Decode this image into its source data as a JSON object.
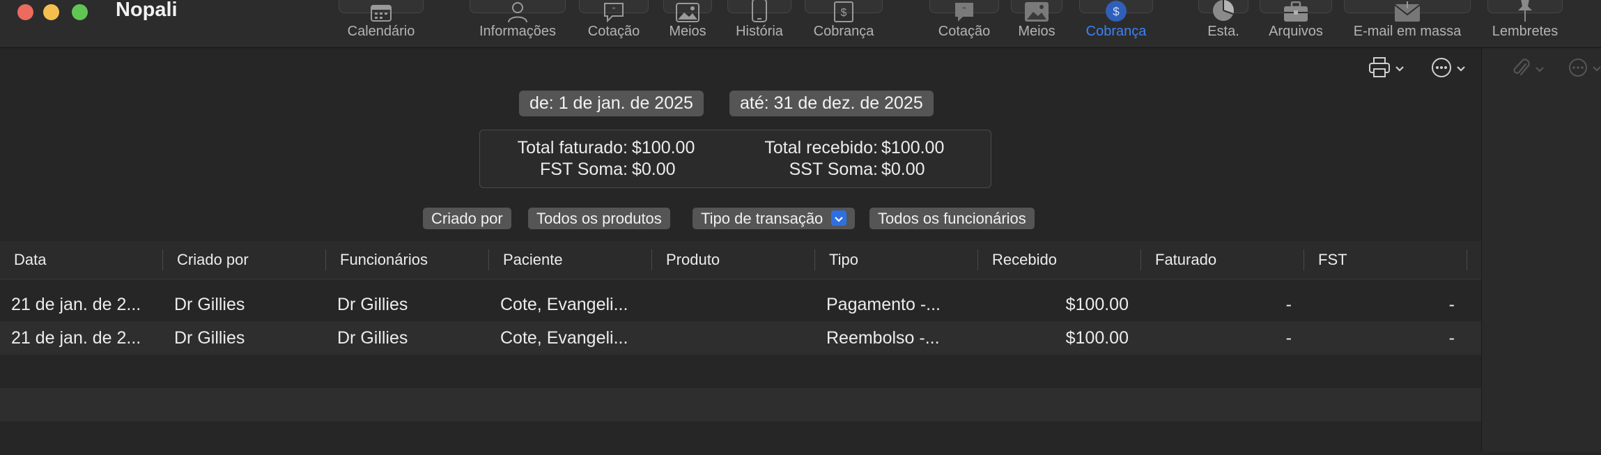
{
  "app": {
    "title": "Nopali"
  },
  "toolbar": {
    "items": [
      {
        "label": "Calendário",
        "icon": "calendar-icon"
      },
      {
        "label": "Informações",
        "icon": "person-icon"
      },
      {
        "label": "Cotação",
        "icon": "speech-bubble-icon"
      },
      {
        "label": "Meios",
        "icon": "photo-icon"
      },
      {
        "label": "História",
        "icon": "phone-icon"
      },
      {
        "label": "Cobrança",
        "icon": "invoice-icon"
      },
      {
        "label": "Cotação",
        "icon": "speech-bubble-icon"
      },
      {
        "label": "Meios",
        "icon": "photo-icon"
      },
      {
        "label": "Cobrança",
        "icon": "dollar-icon",
        "active": true
      },
      {
        "label": "Esta.",
        "icon": "pie-chart-icon"
      },
      {
        "label": "Arquivos",
        "icon": "briefcase-icon"
      },
      {
        "label": "E-mail em massa",
        "icon": "envelope-icon"
      },
      {
        "label": "Lembretes",
        "icon": "pin-icon"
      }
    ],
    "accent": "#3b82f6"
  },
  "date_range": {
    "from": "de: 1 de jan. de 2025",
    "to": "até: 31 de dez. de 2025"
  },
  "summary": {
    "billed_label": "Total faturado:",
    "billed_value": "$100.00",
    "received_label": "Total recebido:",
    "received_value": "$100.00",
    "fst_label": "FST Soma:",
    "fst_value": "$0.00",
    "sst_label": "SST Soma:",
    "sst_value": "$0.00"
  },
  "filters": {
    "created_by": "Criado por",
    "products": "Todos os produtos",
    "transaction_type": "Tipo de transação",
    "employees": "Todos os funcionários"
  },
  "table": {
    "columns": [
      "Data",
      "Criado por",
      "Funcionários",
      "Paciente",
      "Produto",
      "Tipo",
      "Recebido",
      "Faturado",
      "FST"
    ],
    "rows": [
      {
        "data": "21 de jan. de 2...",
        "criado_por": "Dr Gillies",
        "funcionarios": "Dr Gillies",
        "paciente": "Cote, Evangeli...",
        "produto": "",
        "tipo": "Pagamento -...",
        "recebido": "$100.00",
        "faturado": "-",
        "fst": "-"
      },
      {
        "data": "21 de jan. de 2...",
        "criado_por": "Dr Gillies",
        "funcionarios": "Dr Gillies",
        "paciente": "Cote, Evangeli...",
        "produto": "",
        "tipo": "Reembolso -...",
        "recebido": "$100.00",
        "faturado": "-",
        "fst": "-"
      }
    ]
  }
}
